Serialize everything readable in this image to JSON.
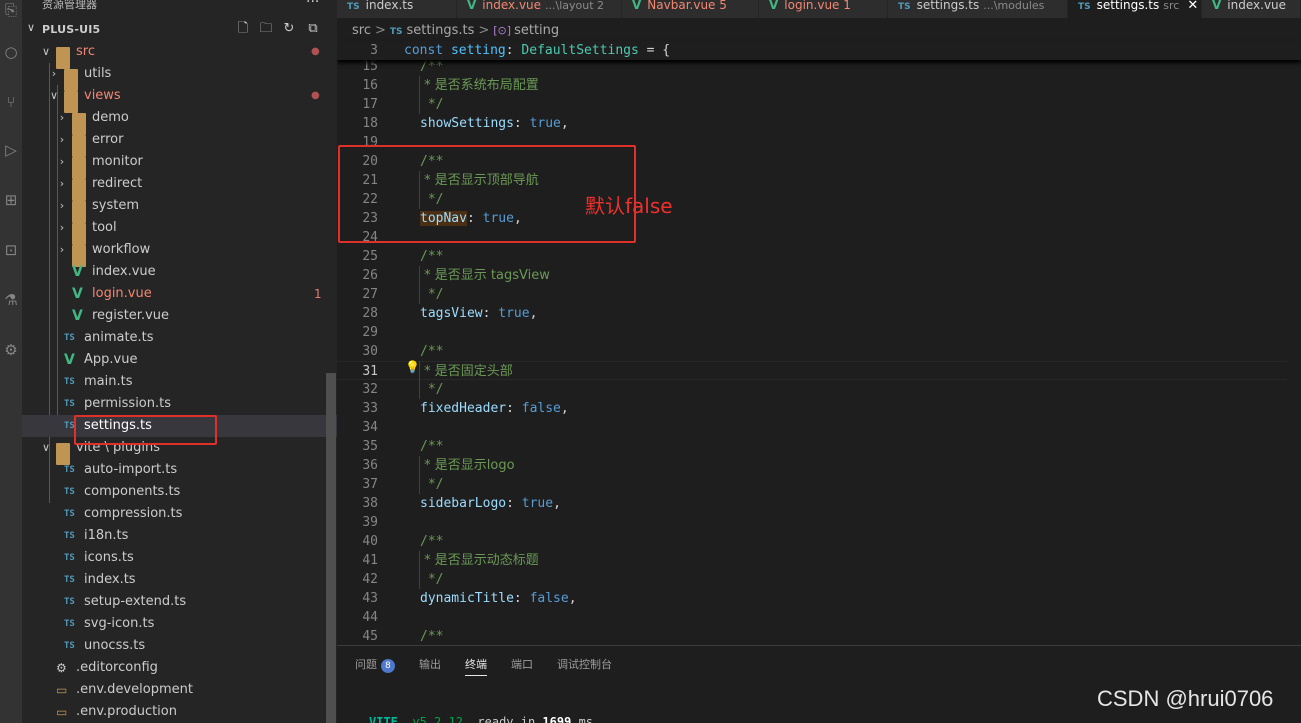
{
  "sidebar": {
    "title": "资源管理器",
    "more_label": "···",
    "root_label": "PLUS-UI5",
    "rows": [
      {
        "label": "src",
        "kind": "folder-open",
        "depth": 1,
        "color": "#f48771",
        "dot": "●"
      },
      {
        "label": "utils",
        "kind": "folder",
        "depth": 2,
        "color": "#cccccc"
      },
      {
        "label": "views",
        "kind": "folder-open",
        "depth": 2,
        "color": "#f48771",
        "dot": "●"
      },
      {
        "label": "demo",
        "kind": "folder",
        "depth": 3,
        "color": "#cccccc"
      },
      {
        "label": "error",
        "kind": "folder",
        "depth": 3,
        "color": "#cccccc"
      },
      {
        "label": "monitor",
        "kind": "folder",
        "depth": 3,
        "color": "#cccccc"
      },
      {
        "label": "redirect",
        "kind": "folder",
        "depth": 3,
        "color": "#cccccc"
      },
      {
        "label": "system",
        "kind": "folder",
        "depth": 3,
        "color": "#cccccc"
      },
      {
        "label": "tool",
        "kind": "folder",
        "depth": 3,
        "color": "#cccccc"
      },
      {
        "label": "workflow",
        "kind": "folder",
        "depth": 3,
        "color": "#cccccc"
      },
      {
        "label": "index.vue",
        "kind": "vue",
        "depth": 3,
        "color": "#cccccc"
      },
      {
        "label": "login.vue",
        "kind": "vue",
        "depth": 3,
        "color": "#f48771",
        "badge": "1"
      },
      {
        "label": "register.vue",
        "kind": "vue",
        "depth": 3,
        "color": "#cccccc"
      },
      {
        "label": "animate.ts",
        "kind": "ts",
        "depth": 2,
        "color": "#cccccc"
      },
      {
        "label": "App.vue",
        "kind": "vue",
        "depth": 2,
        "color": "#cccccc"
      },
      {
        "label": "main.ts",
        "kind": "ts",
        "depth": 2,
        "color": "#cccccc"
      },
      {
        "label": "permission.ts",
        "kind": "ts",
        "depth": 2,
        "color": "#cccccc"
      },
      {
        "label": "settings.ts",
        "kind": "ts",
        "depth": 2,
        "color": "#ffffff",
        "selected": true
      },
      {
        "label": "vite \\ plugins",
        "kind": "folder-open",
        "depth": 1,
        "color": "#cccccc"
      },
      {
        "label": "auto-import.ts",
        "kind": "ts",
        "depth": 2,
        "color": "#cccccc"
      },
      {
        "label": "components.ts",
        "kind": "ts",
        "depth": 2,
        "color": "#cccccc"
      },
      {
        "label": "compression.ts",
        "kind": "ts",
        "depth": 2,
        "color": "#cccccc"
      },
      {
        "label": "i18n.ts",
        "kind": "ts",
        "depth": 2,
        "color": "#cccccc"
      },
      {
        "label": "icons.ts",
        "kind": "ts",
        "depth": 2,
        "color": "#cccccc"
      },
      {
        "label": "index.ts",
        "kind": "ts",
        "depth": 2,
        "color": "#cccccc"
      },
      {
        "label": "setup-extend.ts",
        "kind": "ts",
        "depth": 2,
        "color": "#cccccc"
      },
      {
        "label": "svg-icon.ts",
        "kind": "ts",
        "depth": 2,
        "color": "#cccccc"
      },
      {
        "label": "unocss.ts",
        "kind": "ts",
        "depth": 2,
        "color": "#cccccc"
      },
      {
        "label": ".editorconfig",
        "kind": "gear",
        "depth": 1,
        "color": "#cccccc"
      },
      {
        "label": ".env.development",
        "kind": "env",
        "depth": 1,
        "color": "#cccccc"
      },
      {
        "label": ".env.production",
        "kind": "env",
        "depth": 1,
        "color": "#cccccc"
      }
    ]
  },
  "tabs": [
    {
      "icon": "TS",
      "name": "index.ts",
      "desc": "",
      "state": "normal"
    },
    {
      "icon": "V",
      "name": "index.vue",
      "desc": "...\\layout 2",
      "state": "err"
    },
    {
      "icon": "V",
      "name": "Navbar.vue 5",
      "desc": "",
      "state": "err"
    },
    {
      "icon": "V",
      "name": "login.vue 1",
      "desc": "",
      "state": "err"
    },
    {
      "icon": "TS",
      "name": "settings.ts",
      "desc": "...\\modules",
      "state": "normal"
    },
    {
      "icon": "TS",
      "name": "settings.ts",
      "desc": "src",
      "state": "active",
      "close": "✕"
    },
    {
      "icon": "V",
      "name": "index.vue",
      "desc": "",
      "state": "normal"
    }
  ],
  "breadcrumb": {
    "folder": "src",
    "sep": ">",
    "file_icon": "TS",
    "file": "settings.ts",
    "symbol_icon": "[⊙]",
    "symbol": "setting"
  },
  "editor": {
    "sticky": {
      "n": "3",
      "t": [
        [
          "c-kw",
          "const "
        ],
        [
          "c-var",
          "setting"
        ],
        [
          "c-punc",
          ": "
        ],
        [
          "c-type",
          "DefaultSettings"
        ],
        [
          "c-punc",
          " = {"
        ]
      ]
    },
    "current_line": "31",
    "lines": [
      {
        "n": "15",
        "t": [
          [
            "c-com",
            "/**"
          ]
        ]
      },
      {
        "n": "16",
        "t": [
          [
            "c-com",
            " * 是否系统布局配置"
          ]
        ]
      },
      {
        "n": "17",
        "t": [
          [
            "c-com",
            " */"
          ]
        ]
      },
      {
        "n": "18",
        "t": [
          [
            "c-prop",
            "showSettings"
          ],
          [
            "c-punc",
            ": "
          ],
          [
            "c-kw",
            "true"
          ],
          [
            "c-punc",
            ","
          ]
        ]
      },
      {
        "n": "19",
        "t": []
      },
      {
        "n": "20",
        "t": [
          [
            "c-com",
            "/**"
          ]
        ]
      },
      {
        "n": "21",
        "t": [
          [
            "c-com",
            " * 是否显示顶部导航"
          ]
        ]
      },
      {
        "n": "22",
        "t": [
          [
            "c-com",
            " */"
          ]
        ]
      },
      {
        "n": "23",
        "t": [
          [
            "c-prop hl-word",
            "topNav"
          ],
          [
            "c-punc",
            ": "
          ],
          [
            "c-kw",
            "true"
          ],
          [
            "c-punc",
            ","
          ]
        ]
      },
      {
        "n": "24",
        "t": []
      },
      {
        "n": "25",
        "t": [
          [
            "c-com",
            "/**"
          ]
        ]
      },
      {
        "n": "26",
        "t": [
          [
            "c-com",
            " * 是否显示 tagsView"
          ]
        ]
      },
      {
        "n": "27",
        "t": [
          [
            "c-com",
            " */"
          ]
        ]
      },
      {
        "n": "28",
        "t": [
          [
            "c-prop",
            "tagsView"
          ],
          [
            "c-punc",
            ": "
          ],
          [
            "c-kw",
            "true"
          ],
          [
            "c-punc",
            ","
          ]
        ]
      },
      {
        "n": "29",
        "t": []
      },
      {
        "n": "30",
        "t": [
          [
            "c-com",
            "/**"
          ]
        ]
      },
      {
        "n": "31",
        "t": [
          [
            "c-com",
            " * 是否固定头部"
          ]
        ]
      },
      {
        "n": "32",
        "t": [
          [
            "c-com",
            " */"
          ]
        ]
      },
      {
        "n": "33",
        "t": [
          [
            "c-prop",
            "fixedHeader"
          ],
          [
            "c-punc",
            ": "
          ],
          [
            "c-kw",
            "false"
          ],
          [
            "c-punc",
            ","
          ]
        ]
      },
      {
        "n": "34",
        "t": []
      },
      {
        "n": "35",
        "t": [
          [
            "c-com",
            "/**"
          ]
        ]
      },
      {
        "n": "36",
        "t": [
          [
            "c-com",
            " * 是否显示logo"
          ]
        ]
      },
      {
        "n": "37",
        "t": [
          [
            "c-com",
            " */"
          ]
        ]
      },
      {
        "n": "38",
        "t": [
          [
            "c-prop",
            "sidebarLogo"
          ],
          [
            "c-punc",
            ": "
          ],
          [
            "c-kw",
            "true"
          ],
          [
            "c-punc",
            ","
          ]
        ]
      },
      {
        "n": "39",
        "t": []
      },
      {
        "n": "40",
        "t": [
          [
            "c-com",
            "/**"
          ]
        ]
      },
      {
        "n": "41",
        "t": [
          [
            "c-com",
            " * 是否显示动态标题"
          ]
        ]
      },
      {
        "n": "42",
        "t": [
          [
            "c-com",
            " */"
          ]
        ]
      },
      {
        "n": "43",
        "t": [
          [
            "c-prop",
            "dynamicTitle"
          ],
          [
            "c-punc",
            ": "
          ],
          [
            "c-kw",
            "false"
          ],
          [
            "c-punc",
            ","
          ]
        ]
      },
      {
        "n": "44",
        "t": []
      },
      {
        "n": "45",
        "t": [
          [
            "c-com",
            "/**"
          ]
        ]
      }
    ]
  },
  "annotation": {
    "text": "默认false",
    "color": "#f0302a"
  },
  "panel": {
    "tabs": [
      {
        "label": "问题",
        "badge": "8"
      },
      {
        "label": "输出"
      },
      {
        "label": "终端",
        "active": true
      },
      {
        "label": "端口"
      },
      {
        "label": "调试控制台"
      }
    ],
    "terminal": {
      "vite": "VITE",
      "version": "v5.2.12",
      "text": "ready in",
      "ms_value": "1699",
      "ms_unit": "ms"
    }
  },
  "watermark": "CSDN @hrui0706",
  "colors": {
    "accent": "#e0302a",
    "ts": "#519aba",
    "vue": "#41b883",
    "error_text": "#f48771"
  }
}
